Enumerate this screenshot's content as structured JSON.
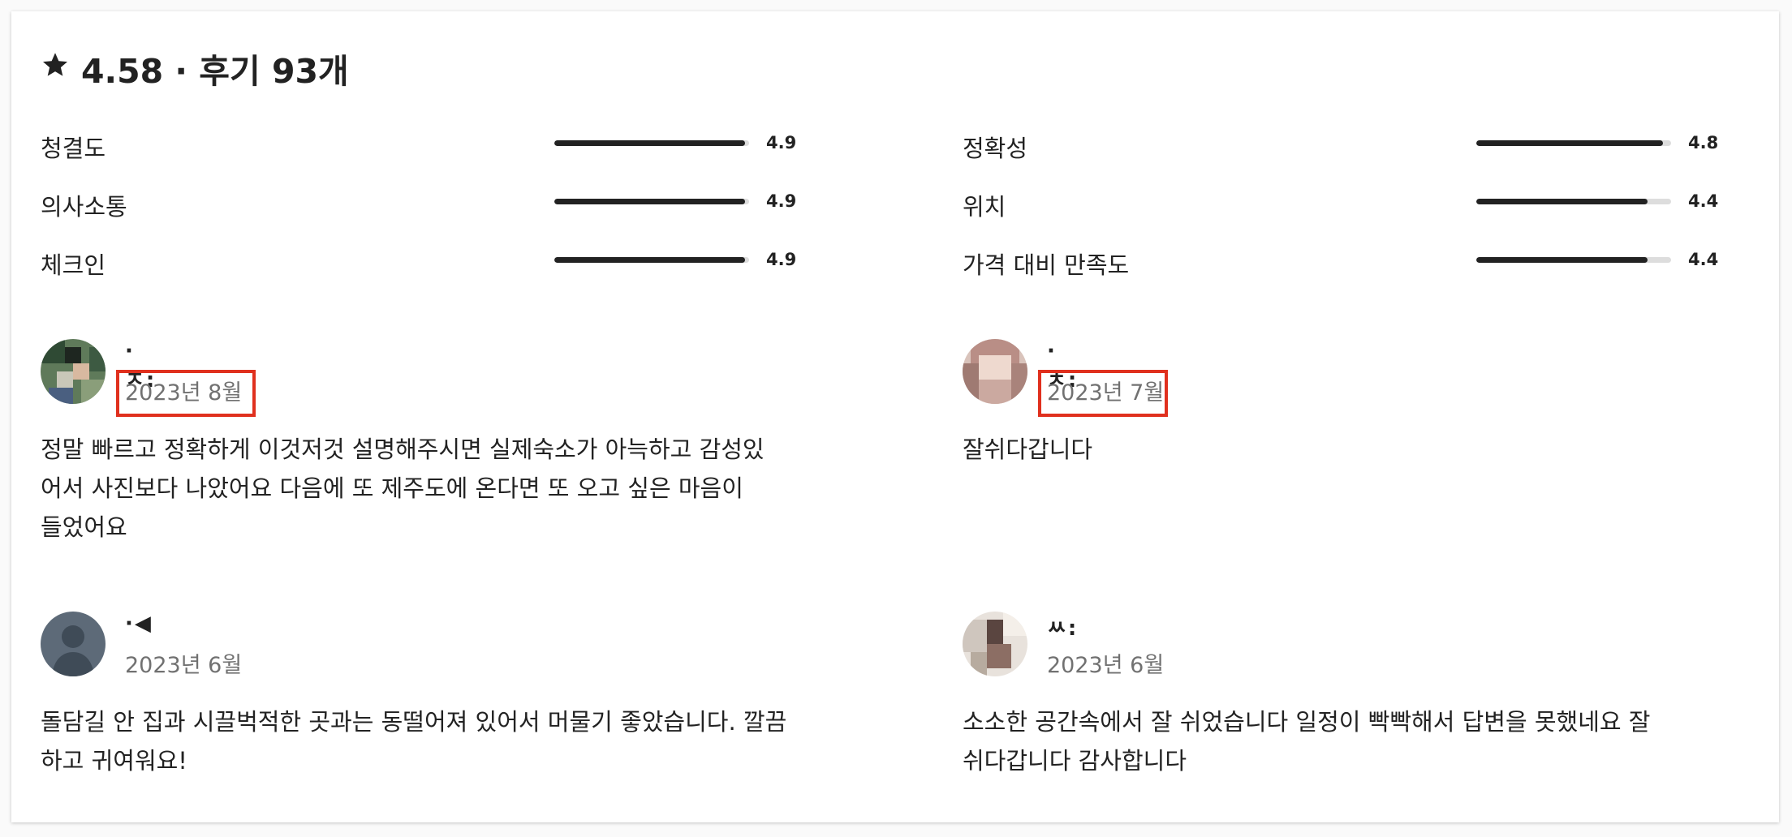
{
  "summary": {
    "star_icon": "star-icon",
    "title": "4.58 · 후기 93개"
  },
  "categories": [
    {
      "label": "청결도",
      "score": "4.9",
      "value": 4.9
    },
    {
      "label": "의사소통",
      "score": "4.9",
      "value": 4.9
    },
    {
      "label": "체크인",
      "score": "4.9",
      "value": 4.9
    },
    {
      "label": "정확성",
      "score": "4.8",
      "value": 4.8
    },
    {
      "label": "위치",
      "score": "4.4",
      "value": 4.4
    },
    {
      "label": "가격 대비 만족도",
      "score": "4.4",
      "value": 4.4
    }
  ],
  "reviews": [
    {
      "name": "·ㅈ:",
      "date": "2023년 8월",
      "text": "정말 빠르고 정확하게 이것저것 설명해주시면 실제숙소가 아늑하고 감성있어서 사진보다 나았어요 다음에 또 제주도에 온다면 또 오고 싶은 마음이 들었어요",
      "highlighted": true
    },
    {
      "name": "·ㅊ:",
      "date": "2023년 7월",
      "text": "잘쉬다갑니다",
      "highlighted": true
    },
    {
      "name": "·◀",
      "date": "2023년 6월",
      "text": "돌담길 안 집과 시끌벅적한 곳과는 동떨어져 있어서 머물기 좋았습니다. 깔끔하고 귀여워요!",
      "highlighted": false
    },
    {
      "name": "ㅆ:",
      "date": "2023년 6월",
      "text": "소소한 공간속에서 잘 쉬었습니다 일정이 빡빡해서 답변을 못했네요 잘쉬다갑니다 감사합니다",
      "highlighted": false
    }
  ],
  "colors": {
    "bar_fill": "#222222",
    "bar_track": "#dddddd",
    "highlight": "#e0301e",
    "date": "#717171"
  }
}
